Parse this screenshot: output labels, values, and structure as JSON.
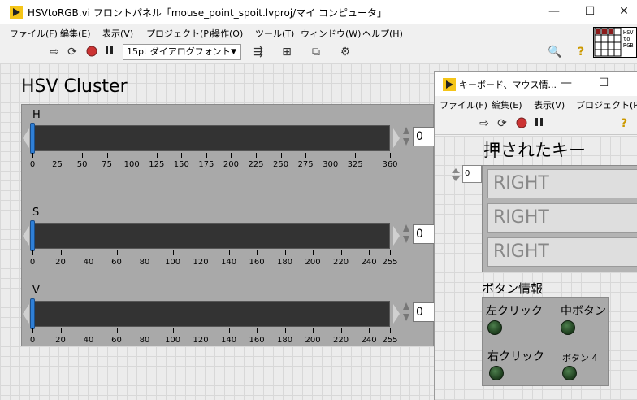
{
  "main_window": {
    "title": "HSVtoRGB.vi フロントパネル「mouse_point_spoit.lvproj/マイ コンピュータ」",
    "window_controls": {
      "minimize": "—",
      "maximize": "☐",
      "close": "✕"
    },
    "menu": [
      "ファイル(F)",
      "編集(E)",
      "表示(V)",
      "プロジェクト(P)",
      "操作(O)",
      "ツール(T)",
      "ウィンドウ(W)",
      "ヘルプ(H)"
    ],
    "toolbar": {
      "font_select": "15pt ダイアログフォント",
      "icons": [
        "run-arrow-icon",
        "run-continuous-icon",
        "abort-icon",
        "pause-icon",
        "align-icon",
        "distribute-icon",
        "resize-icon",
        "reorder-icon",
        "search-icon",
        "help-icon"
      ]
    },
    "vi_icon_text": "HSV to RGB"
  },
  "cluster": {
    "title": "HSV Cluster",
    "sliders": [
      {
        "label": "H",
        "value": "0",
        "min": 0,
        "max": 360,
        "ticks": [
          "0",
          "25",
          "50",
          "75",
          "100",
          "125",
          "150",
          "175",
          "200",
          "225",
          "250",
          "275",
          "300",
          "325",
          "360"
        ]
      },
      {
        "label": "S",
        "value": "0",
        "min": 0,
        "max": 255,
        "ticks": [
          "0",
          "20",
          "40",
          "60",
          "80",
          "100",
          "120",
          "140",
          "160",
          "180",
          "200",
          "220",
          "240",
          "255"
        ]
      },
      {
        "label": "V",
        "value": "0",
        "min": 0,
        "max": 255,
        "ticks": [
          "0",
          "20",
          "40",
          "60",
          "80",
          "100",
          "120",
          "140",
          "160",
          "180",
          "200",
          "220",
          "240",
          "255"
        ]
      }
    ]
  },
  "sub_window": {
    "title": "キーボード、マウス情...",
    "window_controls": {
      "minimize": "—",
      "maximize": "☐"
    },
    "menu": [
      "ファイル(F)",
      "編集(E)",
      "表示(V)",
      "プロジェクト(P)"
    ],
    "key_heading": "押されたキー",
    "key_array_index": "0",
    "keys": [
      "RIGHT",
      "RIGHT",
      "RIGHT"
    ],
    "button_heading": "ボタン情報",
    "buttons": [
      {
        "label": "左クリック"
      },
      {
        "label": "中ボタン"
      },
      {
        "label": "右クリック"
      },
      {
        "label": "ボタン 4"
      }
    ]
  }
}
